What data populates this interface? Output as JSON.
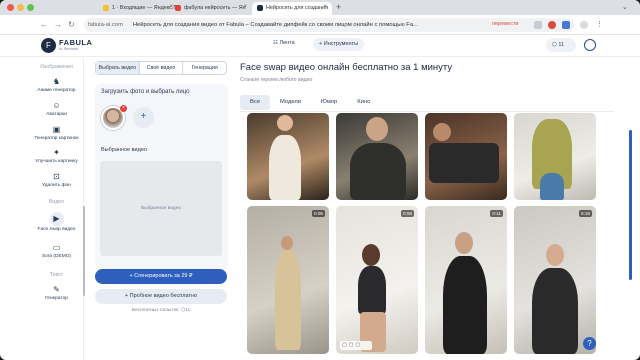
{
  "browser": {
    "tabs": [
      {
        "label": "1 · Входящие — Яндекс.П",
        "active": false,
        "icon_color": "#f2c232"
      },
      {
        "label": "фабула нейросеть — Ян",
        "active": false,
        "icon_color": "#e2413a"
      },
      {
        "label": "Нейросеть для создания",
        "active": true,
        "icon_color": "#1d2b44"
      }
    ],
    "url_host": "fabula-ai.com",
    "url_title": "Нейросеть для создания видео от Fabula – Создавайте дипфейк со своим лицом онлайн с помощью Fa...",
    "translate_label": "перевести"
  },
  "app": {
    "logo_mark": "F",
    "logo_text": "FABULA",
    "logo_sub": "AI Services",
    "feed_label": "☷ Лента",
    "tools_label": "+ Инструменты",
    "credits": "⬡ 11"
  },
  "sidebar": {
    "section_images": "Изображения",
    "items_images": [
      {
        "label": "Аниме генератор",
        "icon": "anime-icon"
      },
      {
        "label": "Аватарки",
        "icon": "avatar-icon"
      },
      {
        "label": "Генератор картинок",
        "icon": "image-icon"
      },
      {
        "label": "Улучшить картинку",
        "icon": "sparkle-icon"
      },
      {
        "label": "Удалить фон",
        "icon": "remove-bg-icon"
      }
    ],
    "section_video": "Видео",
    "items_video": [
      {
        "label": "Face swap видео",
        "icon": "play-icon",
        "active": true
      },
      {
        "label": "Sora (DEMO)",
        "icon": "sora-icon"
      }
    ],
    "section_text": "Текст",
    "items_text": [
      {
        "label": "Генератор",
        "icon": "text-gen-icon"
      }
    ]
  },
  "panel": {
    "segments": [
      "Выбрать видео",
      "Своё видео",
      "Генерация"
    ],
    "upload_title": "Загрузить фото и выбрать лицо",
    "chosen_title": "Выбранное видео",
    "chosen_placeholder": "Выбранное видео",
    "generate_label": "+ Сгенерировать за 29 ₽",
    "trial_label": "+ Пробное видео бесплатно",
    "attempts": "Бесплатных попыток: ⬡11"
  },
  "main": {
    "title": "Face swap видео онлайн бесплатно за 1 минуту",
    "subtitle": "Станьте героем любого видео",
    "filters": [
      "Все",
      "Модели",
      "Юмор",
      "Кино"
    ],
    "row2_durations": [
      "0:06",
      "0:08",
      "0:11",
      "0:18"
    ]
  },
  "colors": {
    "accent": "#2e5fbf",
    "chip_bg": "#e7ebf3",
    "text_dark": "#1d2b44"
  }
}
